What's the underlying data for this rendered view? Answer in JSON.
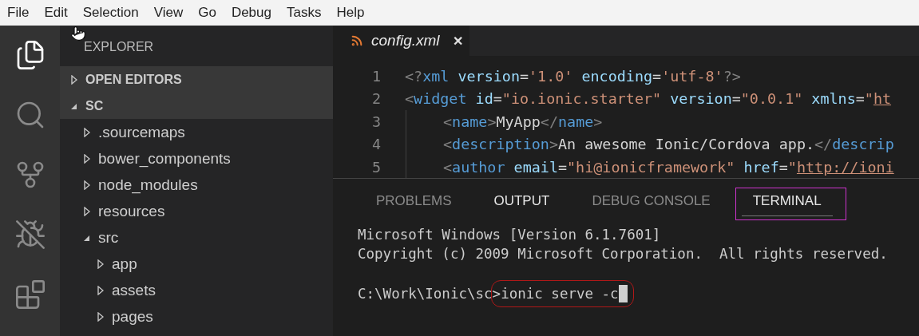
{
  "menu": [
    "File",
    "Edit",
    "Selection",
    "View",
    "Go",
    "Debug",
    "Tasks",
    "Help"
  ],
  "activity_bar": [
    {
      "kind": "explorer",
      "selected": true
    },
    {
      "kind": "search",
      "selected": false
    },
    {
      "kind": "source-control",
      "selected": false
    },
    {
      "kind": "debug",
      "selected": false
    },
    {
      "kind": "extensions",
      "selected": false
    }
  ],
  "sidebar": {
    "title": "EXPLORER",
    "tree": [
      {
        "label": "OPEN EDITORS",
        "kind": "section",
        "expanded": false
      },
      {
        "label": "SC",
        "kind": "section",
        "expanded": true,
        "children": [
          {
            "label": ".sourcemaps",
            "expanded": false
          },
          {
            "label": "bower_components",
            "expanded": false
          },
          {
            "label": "node_modules",
            "expanded": false
          },
          {
            "label": "resources",
            "expanded": false
          },
          {
            "label": "src",
            "expanded": true,
            "children": [
              {
                "label": "app",
                "expanded": false
              },
              {
                "label": "assets",
                "expanded": false
              },
              {
                "label": "pages",
                "expanded": false
              }
            ]
          }
        ]
      }
    ]
  },
  "editor": {
    "tab": {
      "label": "config.xml",
      "close": "✕"
    },
    "lines": [
      {
        "number": "1",
        "indent": false,
        "tokens": [
          {
            "kind": "punct",
            "text": "<?"
          },
          {
            "kind": "tag",
            "text": "xml"
          },
          {
            "kind": "attr",
            "text": " version"
          },
          {
            "kind": "text",
            "text": "="
          },
          {
            "kind": "string",
            "text": "'1.0'"
          },
          {
            "kind": "attr",
            "text": " encoding"
          },
          {
            "kind": "text",
            "text": "="
          },
          {
            "kind": "string",
            "text": "'utf-8'"
          },
          {
            "kind": "punct",
            "text": "?>"
          }
        ]
      },
      {
        "number": "2",
        "indent": false,
        "tokens": [
          {
            "kind": "punct",
            "text": "<"
          },
          {
            "kind": "tag",
            "text": "widget"
          },
          {
            "kind": "attr",
            "text": " id"
          },
          {
            "kind": "text",
            "text": "="
          },
          {
            "kind": "string",
            "text": "\"io.ionic.starter\""
          },
          {
            "kind": "attr",
            "text": " version"
          },
          {
            "kind": "text",
            "text": "="
          },
          {
            "kind": "string",
            "text": "\"0.0.1\""
          },
          {
            "kind": "attr",
            "text": " xmlns"
          },
          {
            "kind": "text",
            "text": "="
          },
          {
            "kind": "string",
            "text": "\""
          },
          {
            "kind": "link",
            "text": "ht"
          }
        ]
      },
      {
        "number": "3",
        "indent": true,
        "tokens": [
          {
            "kind": "punct",
            "text": "<"
          },
          {
            "kind": "tag",
            "text": "name"
          },
          {
            "kind": "punct",
            "text": ">"
          },
          {
            "kind": "text",
            "text": "MyApp"
          },
          {
            "kind": "punct",
            "text": "</"
          },
          {
            "kind": "tag",
            "text": "name"
          },
          {
            "kind": "punct",
            "text": ">"
          }
        ]
      },
      {
        "number": "4",
        "indent": true,
        "tokens": [
          {
            "kind": "punct",
            "text": "<"
          },
          {
            "kind": "tag",
            "text": "description"
          },
          {
            "kind": "punct",
            "text": ">"
          },
          {
            "kind": "text",
            "text": "An awesome Ionic/Cordova app."
          },
          {
            "kind": "punct",
            "text": "</"
          },
          {
            "kind": "tag",
            "text": "descrip"
          }
        ]
      },
      {
        "number": "5",
        "indent": true,
        "tokens": [
          {
            "kind": "punct",
            "text": "<"
          },
          {
            "kind": "tag",
            "text": "author"
          },
          {
            "kind": "attr",
            "text": " email"
          },
          {
            "kind": "text",
            "text": "="
          },
          {
            "kind": "string",
            "text": "\"hi@ionicframework\""
          },
          {
            "kind": "attr",
            "text": " href"
          },
          {
            "kind": "text",
            "text": "="
          },
          {
            "kind": "string",
            "text": "\""
          },
          {
            "kind": "link",
            "text": "http://ioni"
          }
        ]
      }
    ]
  },
  "panel": {
    "tabs": [
      {
        "label": "PROBLEMS",
        "selected": false,
        "hovered": false,
        "outlined": false
      },
      {
        "label": "OUTPUT",
        "selected": false,
        "hovered": true,
        "outlined": false
      },
      {
        "label": "DEBUG CONSOLE",
        "selected": false,
        "hovered": false,
        "outlined": false
      },
      {
        "label": "TERMINAL",
        "selected": true,
        "hovered": false,
        "outlined": true
      }
    ],
    "terminal": {
      "lines": [
        "Microsoft Windows [Version 6.1.7601]",
        "Copyright (c) 2009 Microsoft Corporation.  All rights reserved."
      ],
      "prompt": "C:\\Work\\Ionic\\sc>",
      "command": "ionic serve -c",
      "circled": true
    }
  }
}
